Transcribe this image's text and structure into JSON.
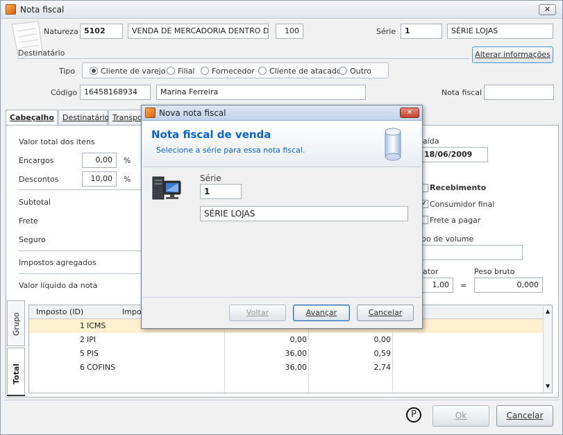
{
  "window": {
    "title": "Nota fiscal",
    "close_label": "✕"
  },
  "header": {
    "natureza_label": "Natureza",
    "natureza_code": "5102",
    "natureza_desc": "VENDA DE MERCADORIA DENTRO DO ES",
    "natureza_num": "100",
    "serie_label": "Série",
    "serie_value": "1",
    "serie_desc": "SÉRIE LOJAS",
    "destinatario_label": "Destinatário",
    "alterar_button": "Alterar informações",
    "tipo_label": "Tipo",
    "tipo_options": [
      "Cliente de varejo",
      "Filial",
      "Fornecedor",
      "Cliente de atacado",
      "Outro"
    ],
    "codigo_label": "Código",
    "codigo_value": "16458168934",
    "nome_value": "Marina Ferreira",
    "nota_fiscal_label": "Nota fiscal",
    "nota_fiscal_value": ""
  },
  "tabs": [
    "Cabeçalho",
    "Destinatário",
    "Transpor"
  ],
  "panel": {
    "valor_total_label": "Valor total dos itens",
    "encargos_label": "Encargos",
    "encargos_value": "0,00",
    "descontos_label": "Descontos",
    "descontos_value": "10,00",
    "percent": "%",
    "subtotal_label": "Subtotal",
    "frete_label": "Frete",
    "seguro_label": "Seguro",
    "impostos_label": "Impostos agregados",
    "valor_liquido_label": "Valor líquido da nota",
    "saida_label": "aída",
    "saida_value": "18/06/2009",
    "recebimento_label": "Recebimento",
    "consumidor_label": "Consumidor final",
    "frete_pagar_label": "Frete a pagar",
    "tipo_volume_label": "po de volume",
    "fator_label": "ator",
    "fator_value": "1,00",
    "equals": "=",
    "peso_bruto_label": "Peso bruto",
    "peso_bruto_value": "0,000"
  },
  "side_tabs": [
    "Grupo",
    "Total"
  ],
  "grid": {
    "headers": [
      "Imposto (ID)",
      "Impos"
    ],
    "rows": [
      {
        "id": "1",
        "name": "ICMS",
        "v1": "",
        "v2": ""
      },
      {
        "id": "2",
        "name": "IPI",
        "v1": "0,00",
        "v2": "0,00"
      },
      {
        "id": "5",
        "name": "PIS",
        "v1": "36,00",
        "v2": "0,59"
      },
      {
        "id": "6",
        "name": "COFINS",
        "v1": "36,00",
        "v2": "2,74"
      }
    ]
  },
  "footer": {
    "p_symbol": "P",
    "ok_button": "Ok",
    "cancel_button": "Cancelar"
  },
  "dialog": {
    "title": "Nova nota fiscal",
    "heading": "Nota fiscal de venda",
    "subheading": "Selecione a série para essa nota fiscal.",
    "serie_label": "Série",
    "serie_value": "1",
    "serie_desc": "SÉRIE LOJAS",
    "voltar_button": "Voltar",
    "avancar_button": "Avançar",
    "cancelar_button": "Cancelar"
  },
  "colors": {
    "accent": "#0a63c9",
    "selected_row": "#fdf0cf"
  }
}
